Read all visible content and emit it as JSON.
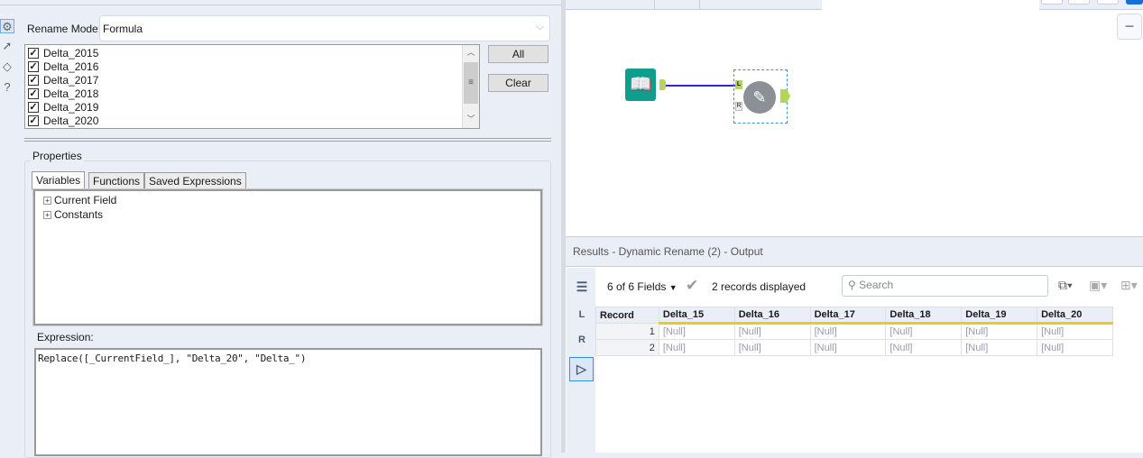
{
  "config": {
    "rename_mode_label": "Rename Mode:",
    "rename_mode_value": "Formula",
    "fields": [
      {
        "name": "Delta_2015",
        "checked": true
      },
      {
        "name": "Delta_2016",
        "checked": true
      },
      {
        "name": "Delta_2017",
        "checked": true
      },
      {
        "name": "Delta_2018",
        "checked": true
      },
      {
        "name": "Delta_2019",
        "checked": true
      },
      {
        "name": "Delta_2020",
        "checked": true
      }
    ],
    "all_label": "All",
    "clear_label": "Clear",
    "properties_label": "Properties",
    "tabs": [
      "Variables",
      "Functions",
      "Saved Expressions"
    ],
    "tree": [
      "Current Field",
      "Constants"
    ],
    "expression_label": "Expression:",
    "expression": "Replace([_CurrentField_], \"Delta_20\", \"Delta_\")"
  },
  "canvas": {
    "zoom_out": "−",
    "anchor_l": "L",
    "anchor_r": "R"
  },
  "results": {
    "title": "Results - Dynamic Rename (2) - Output",
    "fields_selector": "6 of 6 Fields",
    "records_text": "2 records displayed",
    "search_placeholder": "Search",
    "side_l": "L",
    "side_r": "R",
    "columns": [
      "Record",
      "Delta_15",
      "Delta_16",
      "Delta_17",
      "Delta_18",
      "Delta_19",
      "Delta_20"
    ],
    "rows": [
      [
        "1",
        "[Null]",
        "[Null]",
        "[Null]",
        "[Null]",
        "[Null]",
        "[Null]"
      ],
      [
        "2",
        "[Null]",
        "[Null]",
        "[Null]",
        "[Null]",
        "[Null]",
        "[Null]"
      ]
    ]
  },
  "colors": {
    "accent": "#0f9e8e",
    "anchor": "#b5d55a",
    "connection": "#2a2ae6",
    "header_underline": "#f2c81e"
  }
}
